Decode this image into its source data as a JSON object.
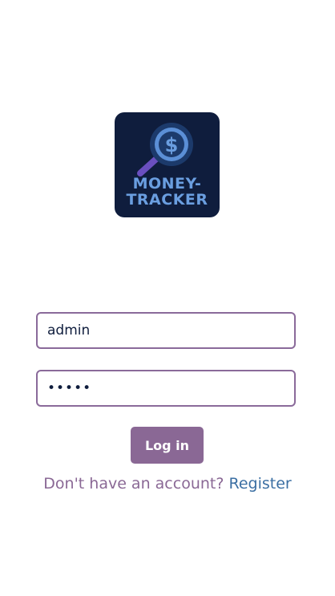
{
  "logo": {
    "line1": "MONEY-",
    "line2": "TRACKER",
    "icon": "dollar-magnifier-icon",
    "background_color": "#0f1d3d",
    "accent_color": "#6a9ee0"
  },
  "form": {
    "username_value": "admin",
    "password_value": "admin",
    "login_label": "Log in"
  },
  "footer": {
    "prompt": "Don't have an account?",
    "register_label": "Register"
  },
  "colors": {
    "primary": "#8a6895",
    "link": "#3b6fa3",
    "field_border": "#8a6a9a"
  }
}
